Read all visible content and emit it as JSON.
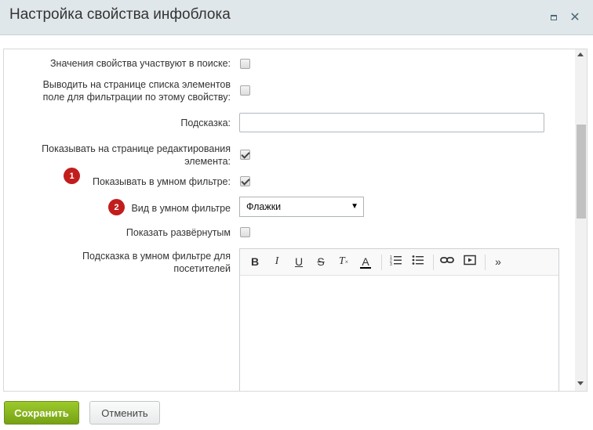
{
  "window": {
    "title": "Настройка свойства инфоблока",
    "maximize_icon": "maximize-icon",
    "close_label": "✕"
  },
  "form": {
    "search_label": "Значения свойства участвуют в поиске:",
    "search_checked": false,
    "filter_label_line1": "Выводить на странице списка элементов",
    "filter_label_line2": "поле для фильтрации по этому свойству:",
    "filter_checked": false,
    "hint_label": "Подсказка:",
    "hint_value": "",
    "show_edit_line1": "Показывать на странице редактирования",
    "show_edit_line2": "элемента:",
    "show_edit_checked": true,
    "smart_filter_badge": "1",
    "smart_filter_label": "Показывать в умном фильтре:",
    "smart_filter_checked": true,
    "smart_view_badge": "2",
    "smart_view_label": "Вид в умном фильтре",
    "smart_view_value": "Флажки",
    "expanded_label": "Показать развёрнутым",
    "expanded_checked": false,
    "visitor_hint_line1": "Подсказка в умном фильтре для",
    "visitor_hint_line2": "посетителей"
  },
  "editor_toolbar": {
    "bold": "B",
    "italic": "I",
    "underline": "U",
    "strike": "S",
    "clear": "T",
    "color": "A",
    "more": "»"
  },
  "buttons": {
    "save": "Сохранить",
    "cancel": "Отменить"
  },
  "colors": {
    "badge": "#c21d1d",
    "save_button": "#8cb822",
    "titlebar": "#e0e7ea"
  }
}
